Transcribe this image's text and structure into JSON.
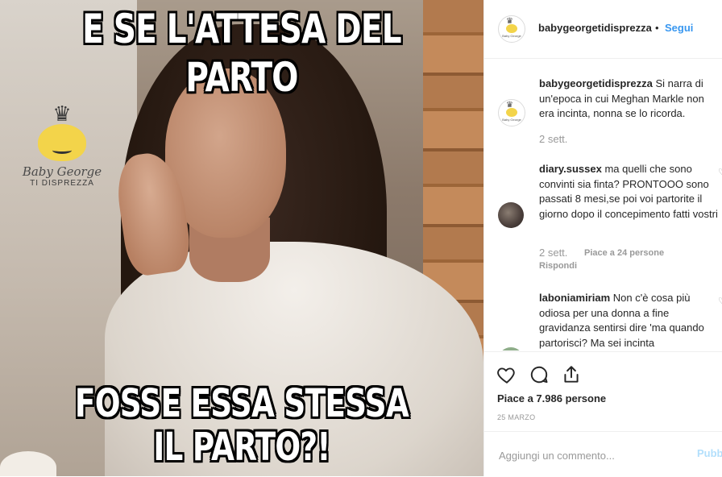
{
  "post": {
    "top_caption": "E SE L'ATTESA DEL PARTO",
    "bottom_caption_line1": "FOSSE ESSA STESSA",
    "bottom_caption_line2": "IL PARTO?!",
    "watermark_brand": "Baby George",
    "watermark_sub": "TI DISPREZZA"
  },
  "header": {
    "username": "babygeorgetidisprezza",
    "separator": "•",
    "follow_label": "Segui",
    "avatar_text": "Baby George"
  },
  "comments": [
    {
      "username": "babygeorgetidisprezza",
      "text": "Si narra di un'epoca in cui Meghan Markle non era incinta, nonna se lo ricorda.",
      "time": "2 sett."
    },
    {
      "username": "diary.sussex",
      "text": "ma quelli che sono convinti sia finta? PRONTOOO sono passati 8 mesi,se poi voi partorite il giorno dopo il concepimento fatti vostri",
      "time": "2 sett.",
      "likes": "Piace a 24 persone",
      "reply": "Rispondi"
    },
    {
      "username": "laboniamiriam",
      "text": "Non c'è cosa più odiosa per una donna a fine gravidanza sentirsi dire 'ma quando partorisci? Ma sei incinta"
    }
  ],
  "actions": {
    "like_icon": "heart-icon",
    "comment_icon": "comment-icon",
    "share_icon": "share-icon",
    "likes_count": "Piace a 7.986 persone",
    "date": "25 MARZO"
  },
  "add_comment": {
    "placeholder": "Aggiungi un commento...",
    "publish_label": "Pubb"
  },
  "colors": {
    "accent": "#3897f0",
    "muted": "#999999",
    "border": "#efefef",
    "publish_disabled": "#b2dffc"
  }
}
